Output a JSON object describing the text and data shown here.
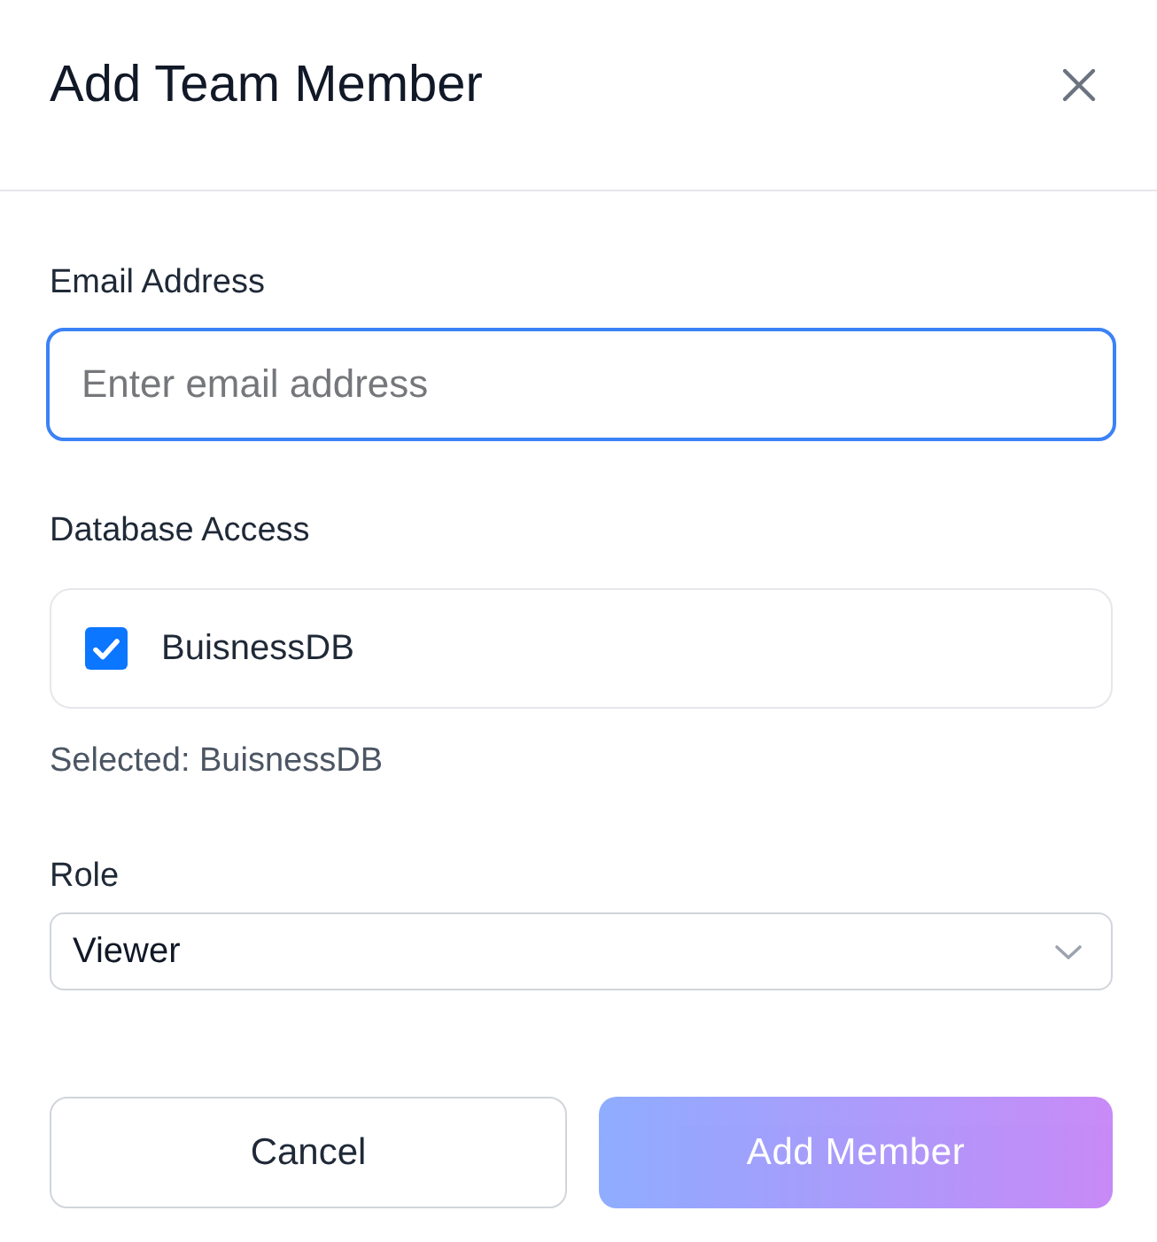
{
  "dialog": {
    "title": "Add Team Member"
  },
  "email": {
    "label": "Email Address",
    "placeholder": "Enter email address",
    "focused": true
  },
  "database_access": {
    "label": "Database Access",
    "options": [
      {
        "label": "BuisnessDB",
        "checked": true
      }
    ],
    "summary": "Selected: BuisnessDB"
  },
  "role": {
    "label": "Role",
    "value": "Viewer"
  },
  "buttons": [
    {
      "label": "Cancel",
      "kind": "secondary",
      "disabled": false
    },
    {
      "label": "Add Member",
      "kind": "primary",
      "disabled": true
    }
  ]
}
